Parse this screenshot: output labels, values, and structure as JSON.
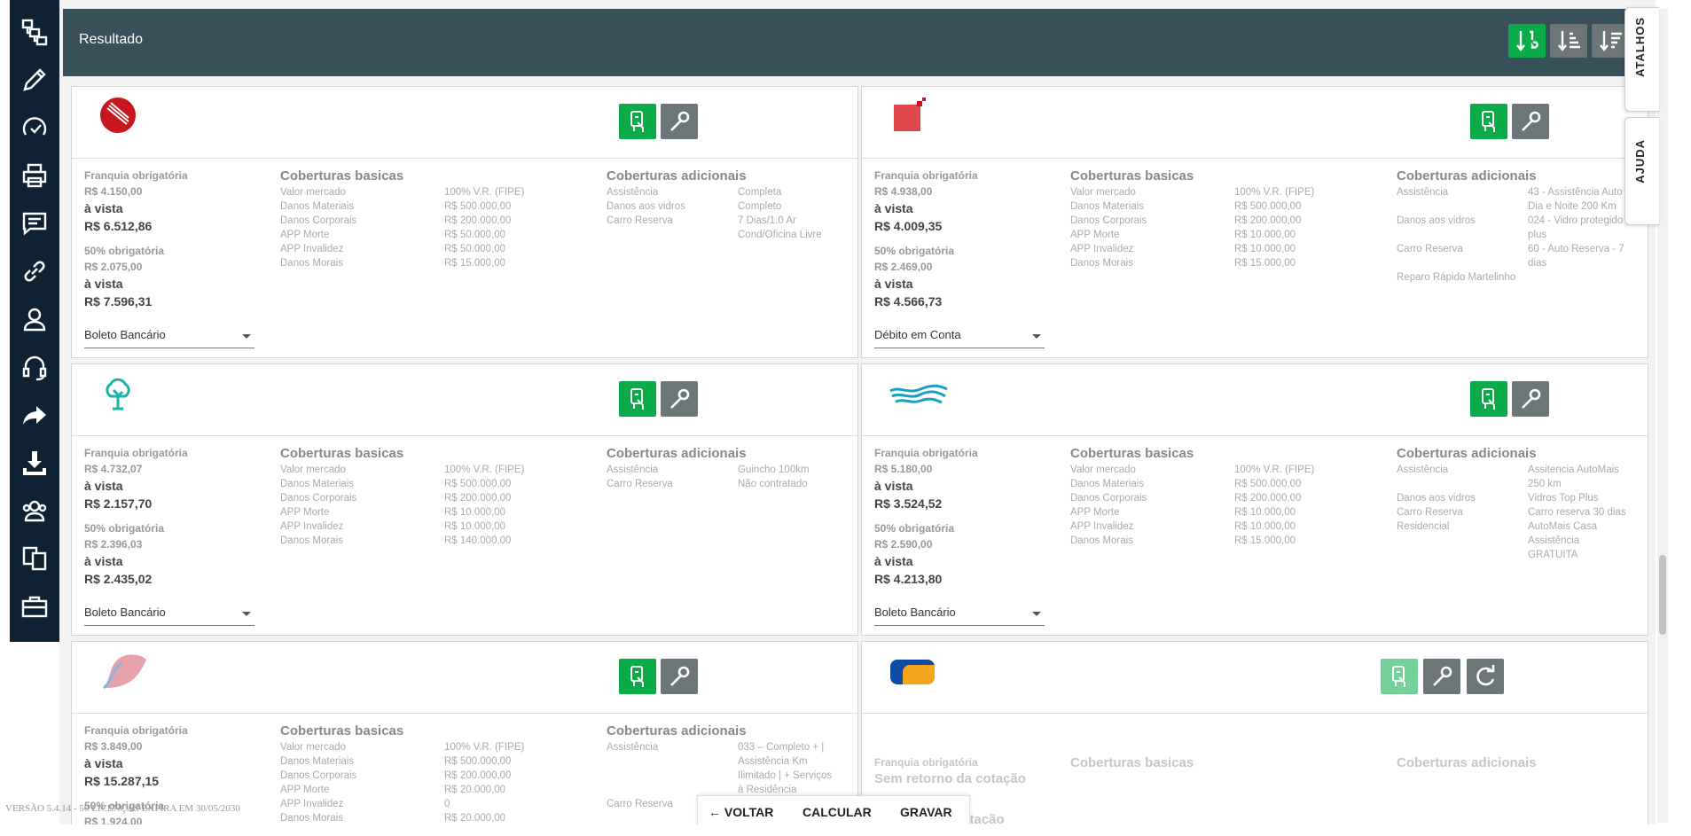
{
  "header": {
    "title": "Resultado"
  },
  "sidebar_icons": [
    "flow-icon",
    "pencil-icon",
    "speedometer-icon",
    "printer-icon",
    "chat-icon",
    "link-icon",
    "user-icon",
    "headset-icon",
    "share-arrow-icon",
    "download-icon",
    "users-icon",
    "copy-icon",
    "briefcase-icon"
  ],
  "sort_buttons": [
    "sort-numeric-icon",
    "sort-list-asc-icon",
    "sort-list-desc-icon"
  ],
  "colors": {
    "header": "#375059",
    "sidebar": "#0e2233",
    "green": "#0aab48",
    "gray": "#6c7679"
  },
  "labels": {
    "franquia": "Franquia obrigatória",
    "cinquenta": "50% obrigatória",
    "vista": "à vista",
    "basicas": "Coberturas basicas",
    "adicionais": "Coberturas adicionais",
    "sem_retorno": "Sem retorno da cotação",
    "cotacao_partial": "cotação"
  },
  "cards": [
    {
      "franquia_val": "R$ 4.150,00",
      "franquia_total": "R$ 6.512,86",
      "cinquenta_val": "R$ 2.075,00",
      "cinquenta_total": "R$ 7.596,31",
      "payment": "Boleto Bancário",
      "basicas": [
        {
          "k": "Valor mercado",
          "v": "100% V.R. (FIPE)"
        },
        {
          "k": "Danos Materiais",
          "v": "R$ 500.000,00"
        },
        {
          "k": "Danos Corporais",
          "v": "R$ 200.000,00"
        },
        {
          "k": "APP Morte",
          "v": "R$ 50.000,00"
        },
        {
          "k": "APP Invalidez",
          "v": "R$ 50.000,00"
        },
        {
          "k": "Danos Morais",
          "v": "R$ 15.000,00"
        }
      ],
      "adicionais": [
        {
          "k": "Assistência",
          "v": "Completa"
        },
        {
          "k": "Danos aos vidros",
          "v": "Completo"
        },
        {
          "k": "Carro Reserva",
          "v": "7 Dias/1.0 Ar Cond/Oficina Livre"
        }
      ]
    },
    {
      "franquia_val": "R$ 4.938,00",
      "franquia_total": "R$ 4.009,35",
      "cinquenta_val": "R$ 2.469,00",
      "cinquenta_total": "R$ 4.566,73",
      "payment": "Débito em Conta",
      "basicas": [
        {
          "k": "Valor mercado",
          "v": "100% V.R. (FIPE)"
        },
        {
          "k": "Danos Materiais",
          "v": "R$ 500.000,00"
        },
        {
          "k": "Danos Corporais",
          "v": "R$ 200.000,00"
        },
        {
          "k": "APP Morte",
          "v": "R$ 10.000,00"
        },
        {
          "k": "APP Invalidez",
          "v": "R$ 10.000,00"
        },
        {
          "k": "Danos Morais",
          "v": "R$ 15.000,00"
        }
      ],
      "adicionais": [
        {
          "k": "Assistência",
          "v": "43 - Assistência Auto Dia e Noite 200 Km"
        },
        {
          "k": "Danos aos vidros",
          "v": "024 - Vidro protegido plus"
        },
        {
          "k": "Carro Reserva",
          "v": "60 - Auto Reserva - 7 dias"
        },
        {
          "k": "Reparo Rápido Martelinho",
          "v": ""
        }
      ]
    },
    {
      "franquia_val": "R$ 4.732,07",
      "franquia_total": "R$ 2.157,70",
      "cinquenta_val": "R$ 2.396,03",
      "cinquenta_total": "R$ 2.435,02",
      "payment": "Boleto Bancário",
      "basicas": [
        {
          "k": "Valor mercado",
          "v": "100% V.R. (FIPE)"
        },
        {
          "k": "Danos Materiais",
          "v": "R$ 500.000,00"
        },
        {
          "k": "Danos Corporais",
          "v": "R$ 200.000,00"
        },
        {
          "k": "APP Morte",
          "v": "R$ 10.000,00"
        },
        {
          "k": "APP Invalidez",
          "v": "R$ 10.000,00"
        },
        {
          "k": "Danos Morais",
          "v": "R$ 140.000,00"
        }
      ],
      "adicionais": [
        {
          "k": "Assistência",
          "v": "Guincho 100km"
        },
        {
          "k": "Carro Reserva",
          "v": "Não contratado"
        }
      ]
    },
    {
      "franquia_val": "R$ 5.180,00",
      "franquia_total": "R$ 3.524,52",
      "cinquenta_val": "R$ 2.590,00",
      "cinquenta_total": "R$ 4.213,80",
      "payment": "Boleto Bancário",
      "basicas": [
        {
          "k": "Valor mercado",
          "v": "100% V.R. (FIPE)"
        },
        {
          "k": "Danos Materiais",
          "v": "R$ 500.000,00"
        },
        {
          "k": "Danos Corporais",
          "v": "R$ 200.000,00"
        },
        {
          "k": "APP Morte",
          "v": "R$ 10.000,00"
        },
        {
          "k": "APP Invalidez",
          "v": "R$ 10.000,00"
        },
        {
          "k": "Danos Morais",
          "v": "R$ 15.000,00"
        }
      ],
      "adicionais": [
        {
          "k": "Assistência",
          "v": "Assitencia AutoMais 250 km"
        },
        {
          "k": "Danos aos vidros",
          "v": "Vidros Top Plus"
        },
        {
          "k": "Carro Reserva",
          "v": "Carro reserva 30 dias"
        },
        {
          "k": "Residencial",
          "v": "AutoMais Casa Assistência GRATUITA"
        }
      ]
    },
    {
      "franquia_val": "R$ 3.849,00",
      "franquia_total": "R$ 15.287,15",
      "cinquenta_val": "R$ 1.924,00",
      "cinquenta_total": "",
      "payment": "",
      "basicas": [
        {
          "k": "Valor mercado",
          "v": "100% V.R. (FIPE)"
        },
        {
          "k": "Danos Materiais",
          "v": "R$ 500.000,00"
        },
        {
          "k": "Danos Corporais",
          "v": "R$ 200.000,00"
        },
        {
          "k": "APP Morte",
          "v": "R$ 20.000,00"
        },
        {
          "k": "APP Invalidez",
          "v": "0"
        },
        {
          "k": "Danos Morais",
          "v": "R$ 20.000,00"
        }
      ],
      "adicionais": [
        {
          "k": "Assistência",
          "v": "033 – Completo + | Assistência Km Ilimitado | + Serviços à Residência"
        },
        {
          "k": "Carro Reserva",
          "v": ""
        }
      ]
    }
  ],
  "side_tabs": {
    "atalhos": "ATALHOS",
    "ajuda": "AJUDA"
  },
  "footer": {
    "voltar": "VOLTAR",
    "calcular": "CALCULAR",
    "gravar": "GRAVAR"
  },
  "version": "VERSÃO 5.4.14 - 50 LICENÇAS EXPIRA EM 30/05/2030"
}
